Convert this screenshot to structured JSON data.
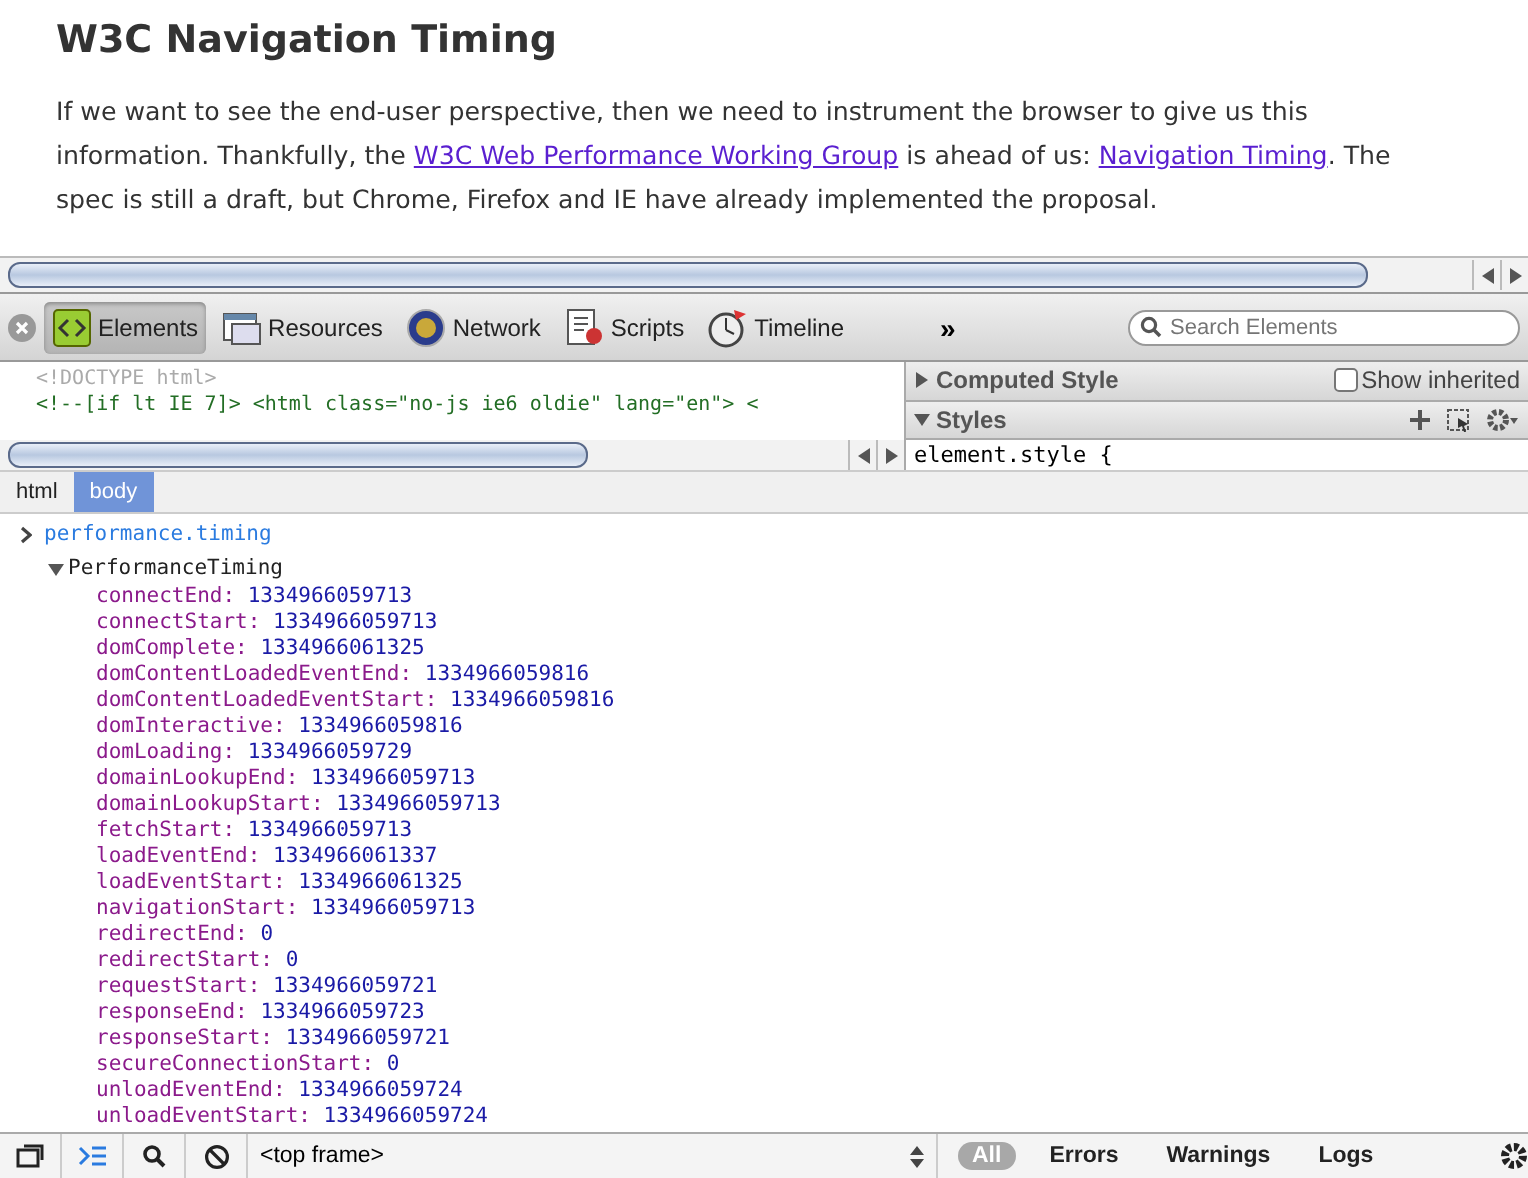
{
  "article": {
    "heading": "W3C Navigation Timing",
    "paragraph": [
      {
        "kind": "text",
        "text": "If we want to see the end-user perspective, then we need to instrument the browser to give us this information. Thankfully, the "
      },
      {
        "kind": "link",
        "text": "W3C Web Performance Working Group"
      },
      {
        "kind": "text",
        "text": " is ahead of us: "
      },
      {
        "kind": "link",
        "text": "Navigation Timing"
      },
      {
        "kind": "text",
        "text": ". The spec is still a draft, but Chrome, Firefox and IE have already implemented the proposal."
      }
    ]
  },
  "toolbar": {
    "tabs": [
      {
        "label": "Elements",
        "kind": "elements",
        "selected": true
      },
      {
        "label": "Resources",
        "kind": "resources",
        "selected": false
      },
      {
        "label": "Network",
        "kind": "network",
        "selected": false
      },
      {
        "label": "Scripts",
        "kind": "scripts",
        "selected": false
      },
      {
        "label": "Timeline",
        "kind": "timeline",
        "selected": false
      }
    ],
    "overflow": "»",
    "search": {
      "placeholder": "Search Elements"
    }
  },
  "elements": {
    "source_lines": [
      {
        "kind": "doctype",
        "text": "<!DOCTYPE html>"
      },
      {
        "kind": "comment",
        "text": "<!--[if lt IE 7]> <html class=\"no-js ie6 oldie\" lang=\"en\"> <"
      }
    ],
    "sidebar": {
      "sections": [
        {
          "title": "Computed Style",
          "expanded": false,
          "checkbox": {
            "label": "Show inherited",
            "checked": false
          }
        },
        {
          "title": "Styles",
          "expanded": true
        }
      ],
      "rule": "element.style {"
    }
  },
  "breadcrumbs": [
    {
      "label": "html",
      "selected": false
    },
    {
      "label": "body",
      "selected": true
    }
  ],
  "console": {
    "command": "performance.timing",
    "object": {
      "name": "PerformanceTiming",
      "expanded": true,
      "properties": [
        {
          "key": "connectEnd: ",
          "value": "1334966059713"
        },
        {
          "key": "connectStart: ",
          "value": "1334966059713"
        },
        {
          "key": "domComplete: ",
          "value": "1334966061325"
        },
        {
          "key": "domContentLoadedEventEnd: ",
          "value": "1334966059816"
        },
        {
          "key": "domContentLoadedEventStart: ",
          "value": "1334966059816"
        },
        {
          "key": "domInteractive: ",
          "value": "1334966059816"
        },
        {
          "key": "domLoading: ",
          "value": "1334966059729"
        },
        {
          "key": "domainLookupEnd: ",
          "value": "1334966059713"
        },
        {
          "key": "domainLookupStart: ",
          "value": "1334966059713"
        },
        {
          "key": "fetchStart: ",
          "value": "1334966059713"
        },
        {
          "key": "loadEventEnd: ",
          "value": "1334966061337"
        },
        {
          "key": "loadEventStart: ",
          "value": "1334966061325"
        },
        {
          "key": "navigationStart: ",
          "value": "1334966059713"
        },
        {
          "key": "redirectEnd: ",
          "value": "0"
        },
        {
          "key": "redirectStart: ",
          "value": "0"
        },
        {
          "key": "requestStart: ",
          "value": "1334966059721"
        },
        {
          "key": "responseEnd: ",
          "value": "1334966059723"
        },
        {
          "key": "responseStart: ",
          "value": "1334966059721"
        },
        {
          "key": "secureConnectionStart: ",
          "value": "0"
        },
        {
          "key": "unloadEventEnd: ",
          "value": "1334966059724"
        },
        {
          "key": "unloadEventStart: ",
          "value": "1334966059724"
        }
      ]
    }
  },
  "status_bar": {
    "frame": "<top frame>",
    "filters": [
      {
        "label": "All",
        "selected": true
      },
      {
        "label": "Errors",
        "selected": false
      },
      {
        "label": "Warnings",
        "selected": false
      },
      {
        "label": "Logs",
        "selected": false
      }
    ]
  }
}
